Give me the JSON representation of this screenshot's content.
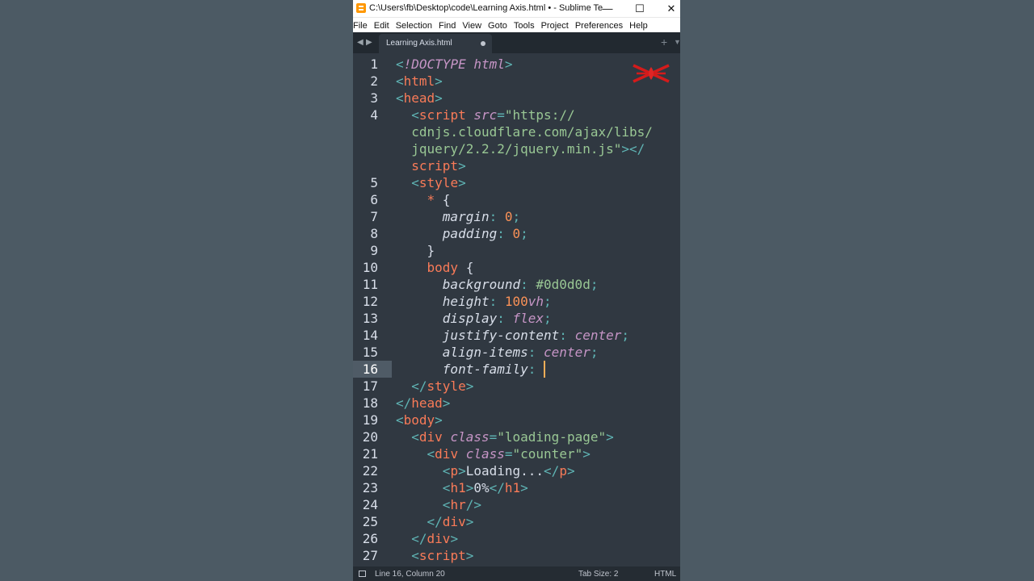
{
  "window": {
    "title": "C:\\Users\\fb\\Desktop\\code\\Learning Axis.html • - Sublime Te...",
    "minimize": "—",
    "maximize": "☐",
    "close": "✕"
  },
  "menu": [
    "File",
    "Edit",
    "Selection",
    "Find",
    "View",
    "Goto",
    "Tools",
    "Project",
    "Preferences",
    "Help"
  ],
  "tabs": {
    "nav_left": "◀",
    "nav_right": "▶",
    "active_label": "Learning Axis.html",
    "plus": "+",
    "more": "▼"
  },
  "lines": [
    {
      "n": "1",
      "parts": [
        [
          "p",
          "<"
        ],
        [
          "a",
          "!DOCTYPE html"
        ],
        [
          "p",
          ">"
        ]
      ]
    },
    {
      "n": "2",
      "parts": [
        [
          "p",
          "<"
        ],
        [
          "t",
          "html"
        ],
        [
          "p",
          ">"
        ]
      ]
    },
    {
      "n": "3",
      "parts": [
        [
          "p",
          "<"
        ],
        [
          "t",
          "head"
        ],
        [
          "p",
          ">"
        ]
      ]
    },
    {
      "n": "4",
      "parts": [
        [
          "",
          "  "
        ],
        [
          "p",
          "<"
        ],
        [
          "t",
          "script "
        ],
        [
          "a",
          "src"
        ],
        [
          "p",
          "="
        ],
        [
          "s",
          "\"https://"
        ]
      ]
    },
    {
      "n": "",
      "parts": [
        [
          "s",
          "  cdnjs.cloudflare.com/ajax/libs/"
        ]
      ]
    },
    {
      "n": "",
      "parts": [
        [
          "s",
          "  jquery/2.2.2/jquery.min.js\""
        ],
        [
          "p",
          "></"
        ]
      ]
    },
    {
      "n": "",
      "parts": [
        [
          "t",
          "  script"
        ],
        [
          "p",
          ">"
        ]
      ]
    },
    {
      "n": "5",
      "parts": [
        [
          "",
          "  "
        ],
        [
          "p",
          "<"
        ],
        [
          "t",
          "style"
        ],
        [
          "p",
          ">"
        ]
      ]
    },
    {
      "n": "6",
      "parts": [
        [
          "",
          "    "
        ],
        [
          "t",
          "*"
        ],
        [
          "",
          " {"
        ]
      ]
    },
    {
      "n": "7",
      "parts": [
        [
          "",
          "      "
        ],
        [
          "k",
          "margin"
        ],
        [
          "p",
          ": "
        ],
        [
          "n",
          "0"
        ],
        [
          "p",
          ";"
        ]
      ]
    },
    {
      "n": "8",
      "parts": [
        [
          "",
          "      "
        ],
        [
          "k",
          "padding"
        ],
        [
          "p",
          ": "
        ],
        [
          "n",
          "0"
        ],
        [
          "p",
          ";"
        ]
      ]
    },
    {
      "n": "9",
      "parts": [
        [
          "",
          "    }"
        ]
      ]
    },
    {
      "n": "10",
      "parts": [
        [
          "",
          "    "
        ],
        [
          "t",
          "body"
        ],
        [
          "",
          " {"
        ]
      ]
    },
    {
      "n": "11",
      "parts": [
        [
          "",
          "      "
        ],
        [
          "k",
          "background"
        ],
        [
          "p",
          ": "
        ],
        [
          "s",
          "#0d0d0d"
        ],
        [
          "p",
          ";"
        ]
      ]
    },
    {
      "n": "12",
      "parts": [
        [
          "",
          "      "
        ],
        [
          "k",
          "height"
        ],
        [
          "p",
          ": "
        ],
        [
          "n",
          "100"
        ],
        [
          "v",
          "vh"
        ],
        [
          "p",
          ";"
        ]
      ]
    },
    {
      "n": "13",
      "parts": [
        [
          "",
          "      "
        ],
        [
          "k",
          "display"
        ],
        [
          "p",
          ": "
        ],
        [
          "v",
          "flex"
        ],
        [
          "p",
          ";"
        ]
      ]
    },
    {
      "n": "14",
      "parts": [
        [
          "",
          "      "
        ],
        [
          "k",
          "justify-content"
        ],
        [
          "p",
          ": "
        ],
        [
          "v",
          "center"
        ],
        [
          "p",
          ";"
        ]
      ]
    },
    {
      "n": "15",
      "parts": [
        [
          "",
          "      "
        ],
        [
          "k",
          "align-items"
        ],
        [
          "p",
          ": "
        ],
        [
          "v",
          "center"
        ],
        [
          "p",
          ";"
        ]
      ]
    },
    {
      "n": "16",
      "parts": [
        [
          "",
          "      "
        ],
        [
          "k",
          "font-family"
        ],
        [
          "p",
          ": "
        ]
      ],
      "current": true
    },
    {
      "n": "17",
      "parts": [
        [
          "",
          "  "
        ],
        [
          "p",
          "</"
        ],
        [
          "t",
          "style"
        ],
        [
          "p",
          ">"
        ]
      ]
    },
    {
      "n": "18",
      "parts": [
        [
          "p",
          "</"
        ],
        [
          "t",
          "head"
        ],
        [
          "p",
          ">"
        ]
      ]
    },
    {
      "n": "19",
      "parts": [
        [
          "p",
          "<"
        ],
        [
          "t",
          "body"
        ],
        [
          "p",
          ">"
        ]
      ]
    },
    {
      "n": "20",
      "parts": [
        [
          "",
          "  "
        ],
        [
          "p",
          "<"
        ],
        [
          "t",
          "div "
        ],
        [
          "a",
          "class"
        ],
        [
          "p",
          "="
        ],
        [
          "s",
          "\"loading-page\""
        ],
        [
          "p",
          ">"
        ]
      ]
    },
    {
      "n": "21",
      "parts": [
        [
          "",
          "    "
        ],
        [
          "p",
          "<"
        ],
        [
          "t",
          "div "
        ],
        [
          "a",
          "class"
        ],
        [
          "p",
          "="
        ],
        [
          "s",
          "\"counter\""
        ],
        [
          "p",
          ">"
        ]
      ]
    },
    {
      "n": "22",
      "parts": [
        [
          "",
          "      "
        ],
        [
          "p",
          "<"
        ],
        [
          "t",
          "p"
        ],
        [
          "p",
          ">"
        ],
        [
          "",
          "Loading..."
        ],
        [
          "p",
          "</"
        ],
        [
          "t",
          "p"
        ],
        [
          "p",
          ">"
        ]
      ]
    },
    {
      "n": "23",
      "parts": [
        [
          "",
          "      "
        ],
        [
          "p",
          "<"
        ],
        [
          "t",
          "h1"
        ],
        [
          "p",
          ">"
        ],
        [
          "",
          "0%"
        ],
        [
          "p",
          "</"
        ],
        [
          "t",
          "h1"
        ],
        [
          "p",
          ">"
        ]
      ]
    },
    {
      "n": "24",
      "parts": [
        [
          "",
          "      "
        ],
        [
          "p",
          "<"
        ],
        [
          "t",
          "hr"
        ],
        [
          "p",
          "/>"
        ]
      ]
    },
    {
      "n": "25",
      "parts": [
        [
          "",
          "    "
        ],
        [
          "p",
          "</"
        ],
        [
          "t",
          "div"
        ],
        [
          "p",
          ">"
        ]
      ]
    },
    {
      "n": "26",
      "parts": [
        [
          "",
          "  "
        ],
        [
          "p",
          "</"
        ],
        [
          "t",
          "div"
        ],
        [
          "p",
          ">"
        ]
      ]
    },
    {
      "n": "27",
      "parts": [
        [
          "",
          "  "
        ],
        [
          "p",
          "<"
        ],
        [
          "t",
          "script"
        ],
        [
          "p",
          ">"
        ]
      ]
    }
  ],
  "status": {
    "position": "Line 16, Column 20",
    "tab_size": "Tab Size: 2",
    "syntax": "HTML"
  },
  "colors": {
    "editor_bg": "#303841",
    "tag": "#f97b58",
    "string": "#99c794",
    "keyword": "#c695c6",
    "caret": "#f9ae58"
  }
}
